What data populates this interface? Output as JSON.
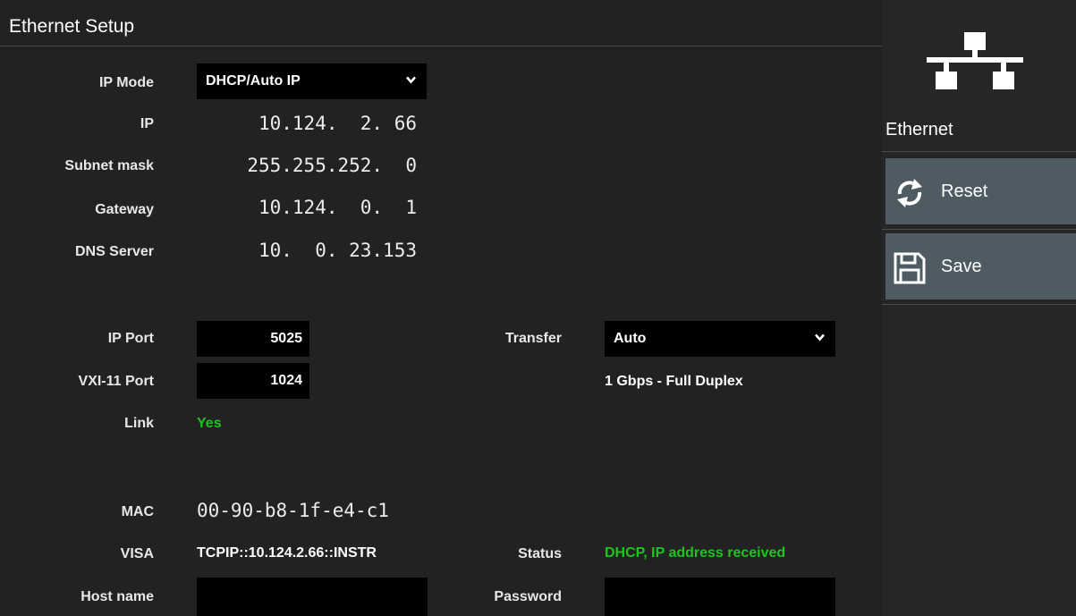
{
  "window": {
    "title": "Ethernet Setup"
  },
  "ip_mode": {
    "label": "IP Mode",
    "value": "DHCP/Auto IP"
  },
  "ip": {
    "label": "IP",
    "value": "10.124.  2. 66"
  },
  "subnet": {
    "label": "Subnet mask",
    "value": "255.255.252.  0"
  },
  "gateway": {
    "label": "Gateway",
    "value": "10.124.  0.  1"
  },
  "dns": {
    "label": "DNS Server",
    "value": "10.  0. 23.153"
  },
  "ip_port": {
    "label": "IP Port",
    "value": "5025"
  },
  "vxi_port": {
    "label": "VXI-11 Port",
    "value": "1024"
  },
  "link": {
    "label": "Link",
    "value": "Yes"
  },
  "transfer": {
    "label": "Transfer",
    "value": "Auto",
    "speed": "1 Gbps - Full Duplex"
  },
  "mac": {
    "label": "MAC",
    "value": "00-90-b8-1f-e4-c1"
  },
  "visa": {
    "label": "VISA",
    "value": "TCPIP::10.124.2.66::INSTR"
  },
  "status": {
    "label": "Status",
    "value": "DHCP, IP address received"
  },
  "host": {
    "label": "Host name",
    "value": ""
  },
  "password": {
    "label": "Password",
    "value": ""
  },
  "sidebar": {
    "title": "Ethernet",
    "icon": "network-icon",
    "reset_label": "Reset",
    "save_label": "Save"
  },
  "colors": {
    "status_green": "#1fc31f",
    "button_bg": "#4e5b63",
    "panel_bg": "#222222"
  }
}
